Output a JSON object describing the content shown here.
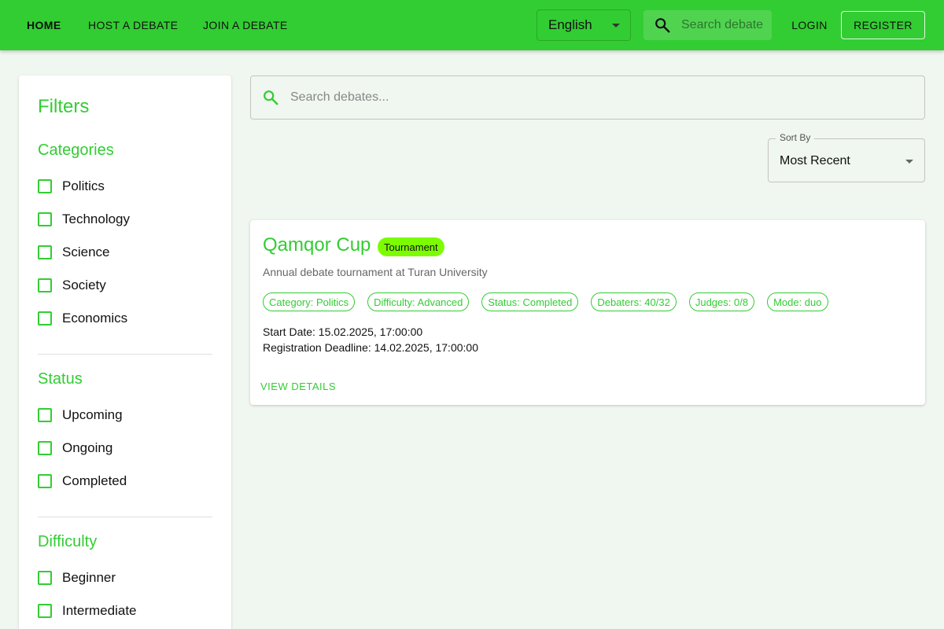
{
  "nav": {
    "home": "HOME",
    "host": "HOST A DEBATE",
    "join": "JOIN A DEBATE",
    "language": "English",
    "search_placeholder": "Search debate",
    "login": "LOGIN",
    "register": "REGISTER"
  },
  "colors": {
    "brand": "#32cd32",
    "badge": "#7cfc00",
    "background": "#f0f6f0"
  },
  "sidebar": {
    "title": "Filters",
    "categories": {
      "title": "Categories",
      "items": [
        "Politics",
        "Technology",
        "Science",
        "Society",
        "Economics"
      ]
    },
    "status": {
      "title": "Status",
      "items": [
        "Upcoming",
        "Ongoing",
        "Completed"
      ]
    },
    "difficulty": {
      "title": "Difficulty",
      "items": [
        "Beginner",
        "Intermediate"
      ]
    }
  },
  "main": {
    "search_placeholder": "Search debates...",
    "sort": {
      "label": "Sort By",
      "value": "Most Recent"
    }
  },
  "debates": [
    {
      "title": "Qamqor Cup",
      "type": "Tournament",
      "description": "Annual debate tournament at Turan University",
      "chips": [
        "Category: Politics",
        "Difficulty: Advanced",
        "Status: Completed",
        "Debaters: 40/32",
        "Judges: 0/8",
        "Mode: duo"
      ],
      "start_date": "Start Date: 15.02.2025, 17:00:00",
      "deadline": "Registration Deadline: 14.02.2025, 17:00:00",
      "action": "VIEW DETAILS"
    }
  ]
}
